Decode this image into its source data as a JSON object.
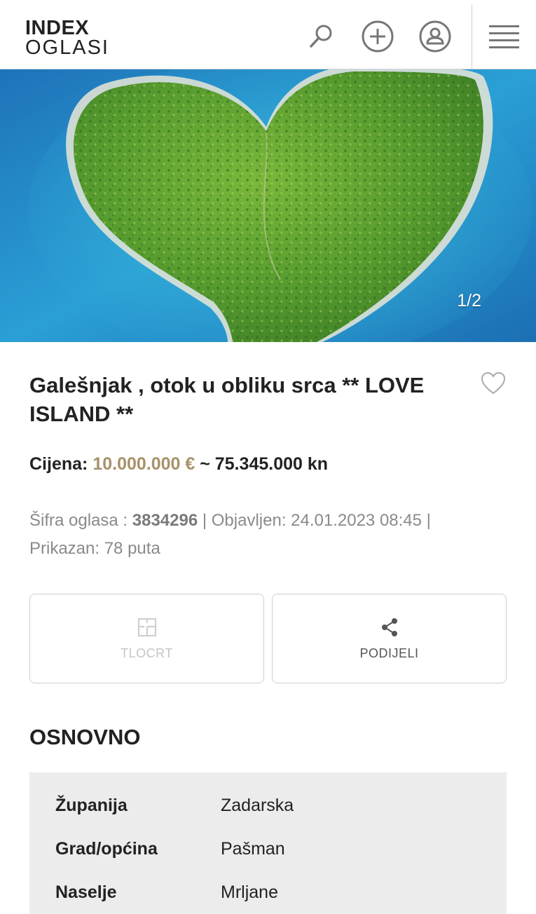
{
  "header": {
    "logo_top": "INDEX",
    "logo_bottom": "OGLASI",
    "icons": [
      "search-icon",
      "add-icon",
      "user-icon",
      "menu-icon"
    ]
  },
  "gallery": {
    "counter": "1/2"
  },
  "listing": {
    "title": "Galešnjak , otok u obliku srca ** LOVE ISLAND **",
    "price_label": "Cijena:",
    "price_eur": "10.000.000 €",
    "price_kn": "~ 75.345.000 kn",
    "id_label": "Šifra oglasa :",
    "id_value": "3834296",
    "published": "| Objavljen: 24.01.2023 08:45 |",
    "views": "Prikazan: 78 puta"
  },
  "actions": {
    "plan_label": "TLOCRT",
    "share_label": "PODIJELI"
  },
  "basic": {
    "title": "OSNOVNO",
    "rows": [
      {
        "key": "Županija",
        "value": "Zadarska"
      },
      {
        "key": "Grad/općina",
        "value": "Pašman"
      },
      {
        "key": "Naselje",
        "value": "Mrljane"
      }
    ]
  },
  "colors": {
    "accent_price": "#a8916a",
    "sea": "#1a8fd0",
    "island": "#4f9a2c"
  }
}
